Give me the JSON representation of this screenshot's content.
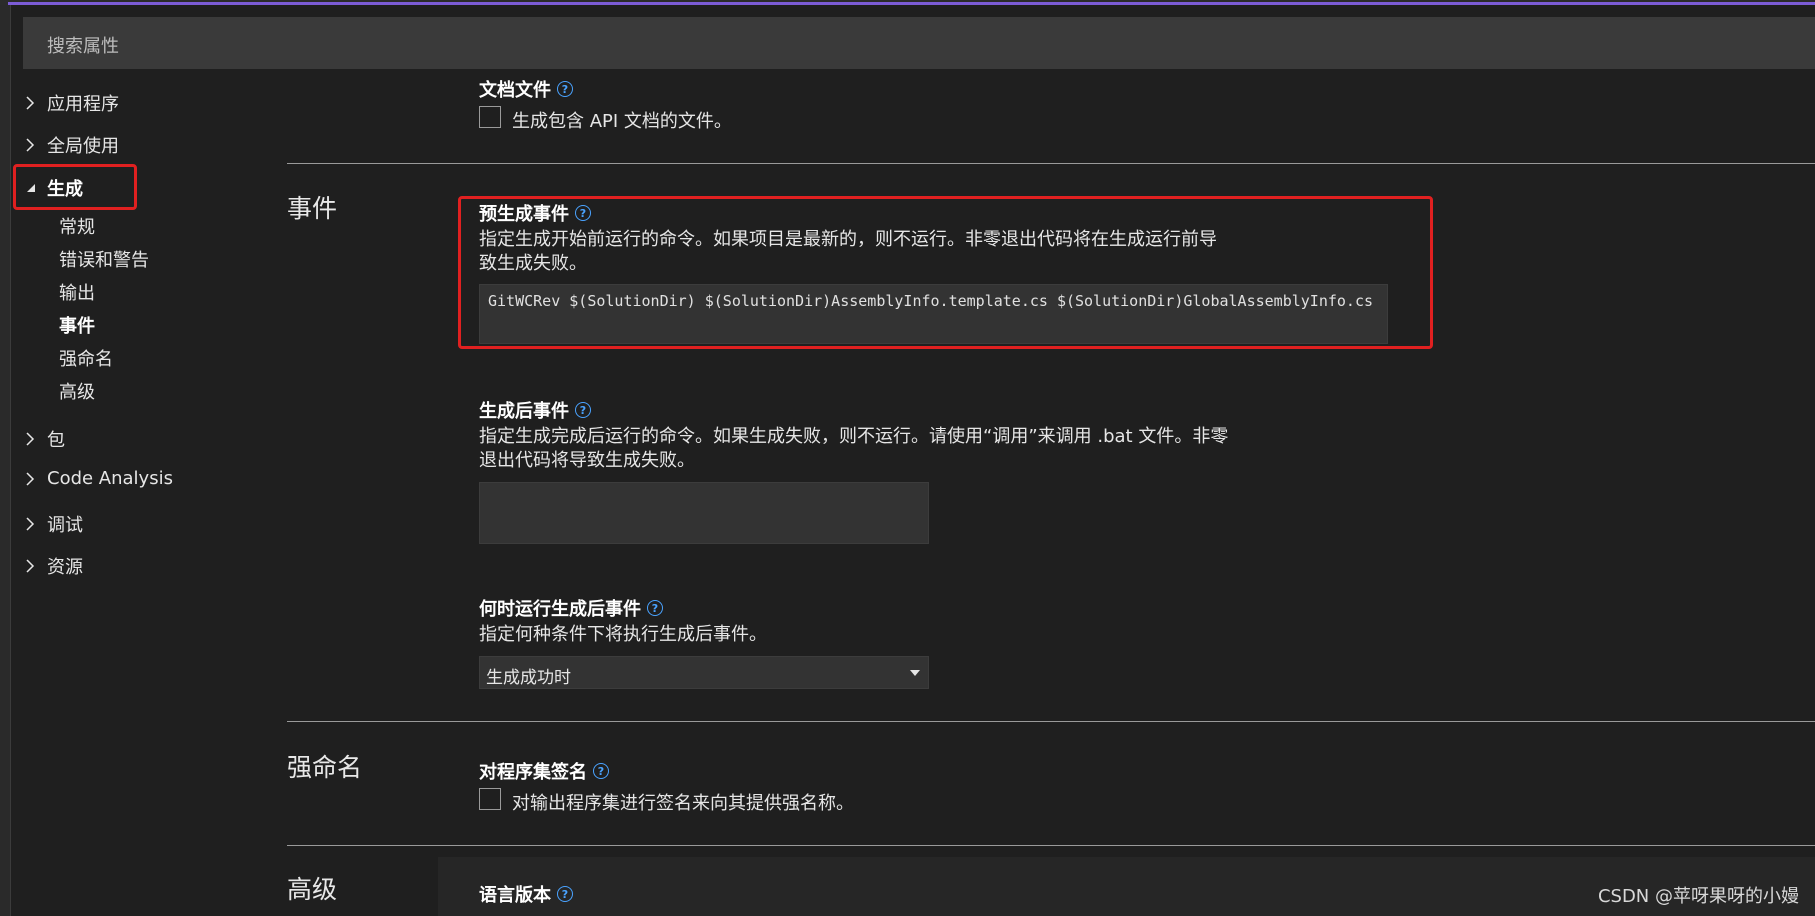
{
  "search": {
    "placeholder": "搜索属性"
  },
  "nav": {
    "groups": [
      {
        "label": "应用程序"
      },
      {
        "label": "全局使用"
      },
      {
        "label": "生成"
      },
      {
        "label": "包"
      },
      {
        "label": "Code Analysis"
      },
      {
        "label": "调试"
      },
      {
        "label": "资源"
      }
    ],
    "sub_items": [
      {
        "label": "常规"
      },
      {
        "label": "错误和警告"
      },
      {
        "label": "输出"
      },
      {
        "label": "事件"
      },
      {
        "label": "强命名"
      },
      {
        "label": "高级"
      }
    ]
  },
  "doc_file": {
    "title": "文档文件",
    "checkbox_label": "生成包含 API 文档的文件。"
  },
  "sections": {
    "events": "事件",
    "strong_name": "强命名",
    "advanced": "高级"
  },
  "pre_build": {
    "title": "预生成事件",
    "desc_line1": "指定生成开始前运行的命令。如果项目是最新的，则不运行。非零退出代码将在生成运行前导",
    "desc_line2": "致生成失败。",
    "command": "GitWCRev $(SolutionDir) $(SolutionDir)AssemblyInfo.template.cs  $(SolutionDir)GlobalAssemblyInfo.cs"
  },
  "post_build": {
    "title": "生成后事件",
    "desc_line1": "指定生成完成后运行的命令。如果生成失败，则不运行。请使用“调用”来调用 .bat 文件。非零",
    "desc_line2": "退出代码将导致生成失败。",
    "command": ""
  },
  "run_post_build": {
    "title": "何时运行生成后事件",
    "desc": "指定何种条件下将执行生成后事件。",
    "selected": "生成成功时"
  },
  "sign_assembly": {
    "title": "对程序集签名",
    "checkbox_label": "对输出程序集进行签名来向其提供强名称。"
  },
  "language_version": {
    "title": "语言版本"
  },
  "help_glyph": "?",
  "watermark": "CSDN @苹呀果呀的小嫚",
  "colors": {
    "accent": "#7c5cd6",
    "highlight_box": "#e02020",
    "help_icon": "#4aa3ff"
  }
}
